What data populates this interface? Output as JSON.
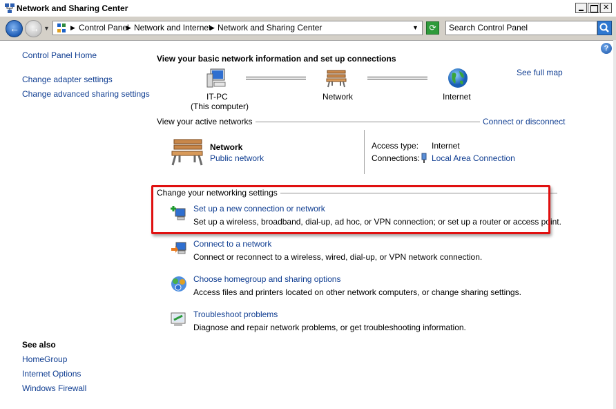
{
  "window": {
    "title": "Network and Sharing Center"
  },
  "address_bar": {
    "breadcrumbs": [
      "Control Panel",
      "Network and Internet",
      "Network and Sharing Center"
    ],
    "search_placeholder": "Search Control Panel"
  },
  "sidebar": {
    "home": "Control Panel Home",
    "tasks": [
      "Change adapter settings",
      "Change advanced sharing settings"
    ],
    "see_also_title": "See also",
    "see_also": [
      "HomeGroup",
      "Internet Options",
      "Windows Firewall"
    ]
  },
  "main": {
    "heading": "View your basic network information and set up connections",
    "see_full_map": "See full map",
    "map": {
      "computer": {
        "name": "IT-PC",
        "sub": "(This computer)",
        "icon": "computer-icon"
      },
      "network": {
        "name": "Network",
        "icon": "network-bench-icon"
      },
      "internet": {
        "name": "Internet",
        "icon": "globe-icon"
      }
    },
    "active_networks_label": "View your active networks",
    "connect_or_disconnect": "Connect or disconnect",
    "active_network": {
      "name": "Network",
      "type_link": "Public network",
      "access_type_label": "Access type:",
      "access_type_value": "Internet",
      "connections_label": "Connections:",
      "connections_value": "Local Area Connection"
    },
    "networking_settings_label": "Change your networking settings",
    "tasks": [
      {
        "title": "Set up a new connection or network",
        "desc": "Set up a wireless, broadband, dial-up, ad hoc, or VPN connection; or set up a router or access point.",
        "icon": "new-connection-icon"
      },
      {
        "title": "Connect to a network",
        "desc": "Connect or reconnect to a wireless, wired, dial-up, or VPN network connection.",
        "icon": "connect-network-icon"
      },
      {
        "title": "Choose homegroup and sharing options",
        "desc": "Access files and printers located on other network computers, or change sharing settings.",
        "icon": "homegroup-icon"
      },
      {
        "title": "Troubleshoot problems",
        "desc": "Diagnose and repair network problems, or get troubleshooting information.",
        "icon": "troubleshoot-icon"
      }
    ]
  },
  "colors": {
    "link": "#0f3d91",
    "highlight": "#e01010"
  }
}
